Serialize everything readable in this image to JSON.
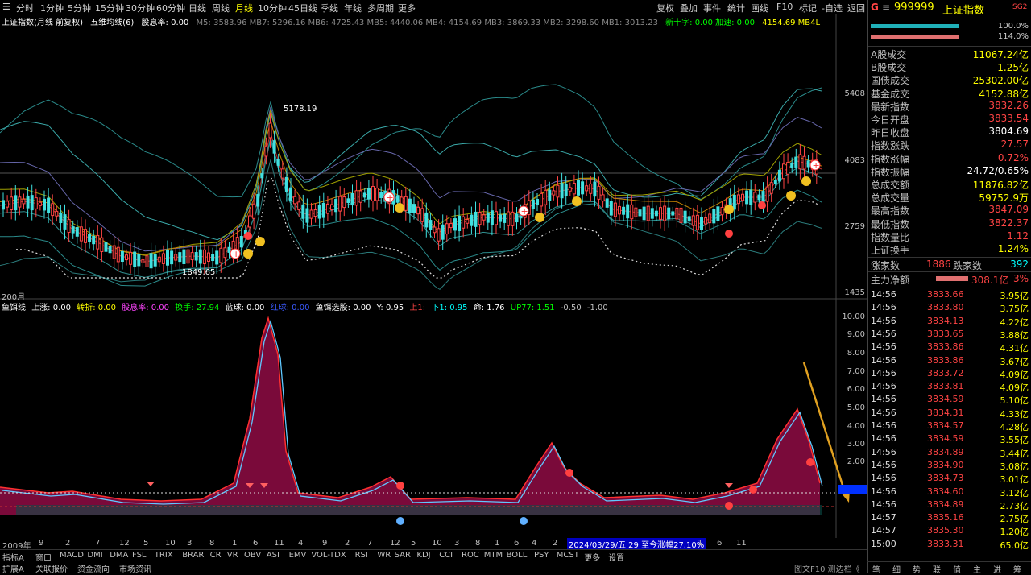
{
  "toolbar": {
    "periods": [
      "分时",
      "1分钟",
      "5分钟",
      "15分钟",
      "30分钟",
      "60分钟",
      "日线",
      "周线",
      "月线",
      "10分钟",
      "45日线",
      "季线",
      "年线",
      "多周期",
      "更多"
    ],
    "active": "月线",
    "right": [
      "复权",
      "叠加",
      "事件",
      "统计",
      "画线",
      "F10",
      "标记",
      "-自选",
      "返回"
    ]
  },
  "info_main": {
    "title": "上证指数(月线 前复权)",
    "indicator": "五维均线(6)",
    "rate": "股息率: 0.00",
    "mas": "M5: 3583.96  MB7: 5296.16  MB6: 4725.43  MB5: 4440.06  MB4: 4154.69  MB3: 3869.33  MB2: 3298.60  MB1: 3013.23",
    "extra": "新十字: 0.00   加速: 0.00",
    "extra2": "4154.69  MB4L"
  },
  "info_sub": {
    "name": "鱼饵线",
    "items": [
      "上涨: 0.00",
      "转折: 0.00",
      "股息率: 0.00",
      "换手: 27.94",
      "蓝球: 0.00",
      "红球: 0.00",
      "鱼饵选股: 0.00",
      "Y: 0.95",
      "上1: ",
      "下1: 0.95",
      "命: 1.76",
      "UP77: 1.51",
      "-0.50",
      "-1.00"
    ]
  },
  "axis_main": [
    "5408",
    "4083",
    "2759",
    "1435"
  ],
  "axis_sub": [
    "10.00",
    "9.00",
    "8.00",
    "7.00",
    "6.00",
    "5.00",
    "4.00",
    "3.00",
    "2.00"
  ],
  "annotations": {
    "high": "5178.19",
    "low": "1849.65",
    "count": "200月"
  },
  "date_axis": {
    "labels": [
      "2009年",
      "9",
      "2",
      "7",
      "12",
      "5",
      "10",
      "3",
      "8",
      "1",
      "6",
      "11",
      "4",
      "9",
      "2",
      "7",
      "12",
      "5",
      "10",
      "3",
      "8",
      "1",
      "6",
      "11",
      "4",
      "9",
      "2",
      "7"
    ],
    "highlight": "2024/03/29/五 29 至今涨幅27.10%",
    "tail": [
      "1",
      "6",
      "11"
    ]
  },
  "tabs1": [
    "指标A",
    "窗口",
    "MACD",
    "DMI",
    "DMA",
    "FSL",
    "TRIX",
    "BRAR",
    "CR",
    "VR",
    "OBV",
    "ASI",
    "EMV",
    "VOL-TDX",
    "RSI",
    "WR",
    "SAR",
    "KDJ",
    "CCI",
    "ROC",
    "MTM",
    "BOLL",
    "PSY",
    "MCST",
    "更多",
    "设置"
  ],
  "tabs2": [
    "扩展A",
    "关联报价",
    "资金流向",
    "市场资讯"
  ],
  "panel": {
    "code": "999999",
    "name": "上证指数",
    "tag": "SG2",
    "ratio_top": "100.0%",
    "ratio_bot": "114.0%",
    "stats": [
      {
        "label": "A股成交",
        "value": "11067.24亿",
        "color": "#ffff00"
      },
      {
        "label": "B股成交",
        "value": "1.25亿",
        "color": "#ffff00"
      },
      {
        "label": "国债成交",
        "value": "25302.00亿",
        "color": "#ffff00"
      },
      {
        "label": "基金成交",
        "value": "4152.88亿",
        "color": "#ffff00"
      },
      {
        "label": "最新指数",
        "value": "3832.26",
        "color": "#ff4444"
      },
      {
        "label": "今日开盘",
        "value": "3833.54",
        "color": "#ff4444"
      },
      {
        "label": "昨日收盘",
        "value": "3804.69",
        "color": "#ffffff"
      },
      {
        "label": "指数涨跌",
        "value": "27.57",
        "color": "#ff4444"
      },
      {
        "label": "指数涨幅",
        "value": "0.72%",
        "color": "#ff4444"
      },
      {
        "label": "指数振幅",
        "value": "24.72/0.65%",
        "color": "#ffffff"
      },
      {
        "label": "总成交额",
        "value": "11876.82亿",
        "color": "#ffff00"
      },
      {
        "label": "总成交量",
        "value": "59752.9万",
        "color": "#ffff00"
      },
      {
        "label": "最高指数",
        "value": "3847.09",
        "color": "#ff4444"
      },
      {
        "label": "最低指数",
        "value": "3822.37",
        "color": "#ff4444"
      },
      {
        "label": "指数量比",
        "value": "1.12",
        "color": "#ff4444"
      },
      {
        "label": "上证换手",
        "value": "1.24%",
        "color": "#ffff00"
      }
    ],
    "updown": {
      "up_label": "涨家数",
      "up": "1886",
      "down_label": "跌家数",
      "down": "392"
    },
    "main_flow": {
      "label": "主力净额",
      "value": "308.1亿",
      "pct": "3%"
    },
    "ticks": [
      {
        "t": "14:56",
        "p": "3833.66",
        "v": "3.95亿"
      },
      {
        "t": "14:56",
        "p": "3833.80",
        "v": "3.75亿"
      },
      {
        "t": "14:56",
        "p": "3834.13",
        "v": "4.22亿"
      },
      {
        "t": "14:56",
        "p": "3833.65",
        "v": "3.88亿"
      },
      {
        "t": "14:56",
        "p": "3833.86",
        "v": "4.31亿"
      },
      {
        "t": "14:56",
        "p": "3833.86",
        "v": "3.67亿"
      },
      {
        "t": "14:56",
        "p": "3833.72",
        "v": "4.09亿"
      },
      {
        "t": "14:56",
        "p": "3833.81",
        "v": "4.09亿"
      },
      {
        "t": "14:56",
        "p": "3834.59",
        "v": "5.10亿"
      },
      {
        "t": "14:56",
        "p": "3834.31",
        "v": "4.33亿"
      },
      {
        "t": "14:56",
        "p": "3834.57",
        "v": "4.28亿"
      },
      {
        "t": "14:56",
        "p": "3834.59",
        "v": "3.55亿"
      },
      {
        "t": "14:56",
        "p": "3834.89",
        "v": "3.44亿"
      },
      {
        "t": "14:56",
        "p": "3834.90",
        "v": "3.08亿"
      },
      {
        "t": "14:56",
        "p": "3834.73",
        "v": "3.01亿"
      },
      {
        "t": "14:56",
        "p": "3834.60",
        "v": "3.12亿"
      },
      {
        "t": "14:56",
        "p": "3834.89",
        "v": "2.73亿"
      },
      {
        "t": "14:57",
        "p": "3835.16",
        "v": "2.75亿"
      },
      {
        "t": "14:57",
        "p": "3835.30",
        "v": "1.20亿"
      },
      {
        "t": "15:00",
        "p": "3833.31",
        "v": "65.0亿"
      }
    ],
    "tabs": [
      "笔",
      "细",
      "势",
      "联",
      "值",
      "主",
      "进",
      "筹"
    ],
    "f10": "图文F10 测边栏《"
  },
  "colors": {
    "up": "#ff4444",
    "down": "#00ffff",
    "accent": "#ffff00",
    "fill": "#7a0a3a",
    "teal": "#0c5c55"
  }
}
